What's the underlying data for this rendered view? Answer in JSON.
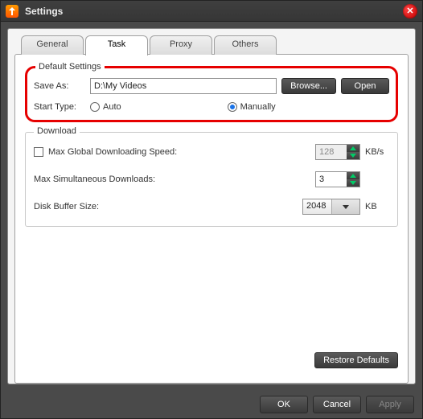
{
  "title": "Settings",
  "tabs": {
    "general": "General",
    "task": "Task",
    "proxy": "Proxy",
    "others": "Others"
  },
  "default_settings": {
    "legend": "Default Settings",
    "save_as_label": "Save As:",
    "save_as_value": "D:\\My Videos",
    "browse": "Browse...",
    "open": "Open",
    "start_type_label": "Start Type:",
    "auto": "Auto",
    "manually": "Manually"
  },
  "download": {
    "legend": "Download",
    "max_global_label": "Max Global Downloading Speed:",
    "max_global_value": "128",
    "max_global_unit": "KB/s",
    "max_sim_label": "Max Simultaneous Downloads:",
    "max_sim_value": "3",
    "buffer_label": "Disk Buffer Size:",
    "buffer_value": "2048",
    "buffer_unit": "KB"
  },
  "buttons": {
    "restore": "Restore Defaults",
    "ok": "OK",
    "cancel": "Cancel",
    "apply": "Apply"
  }
}
